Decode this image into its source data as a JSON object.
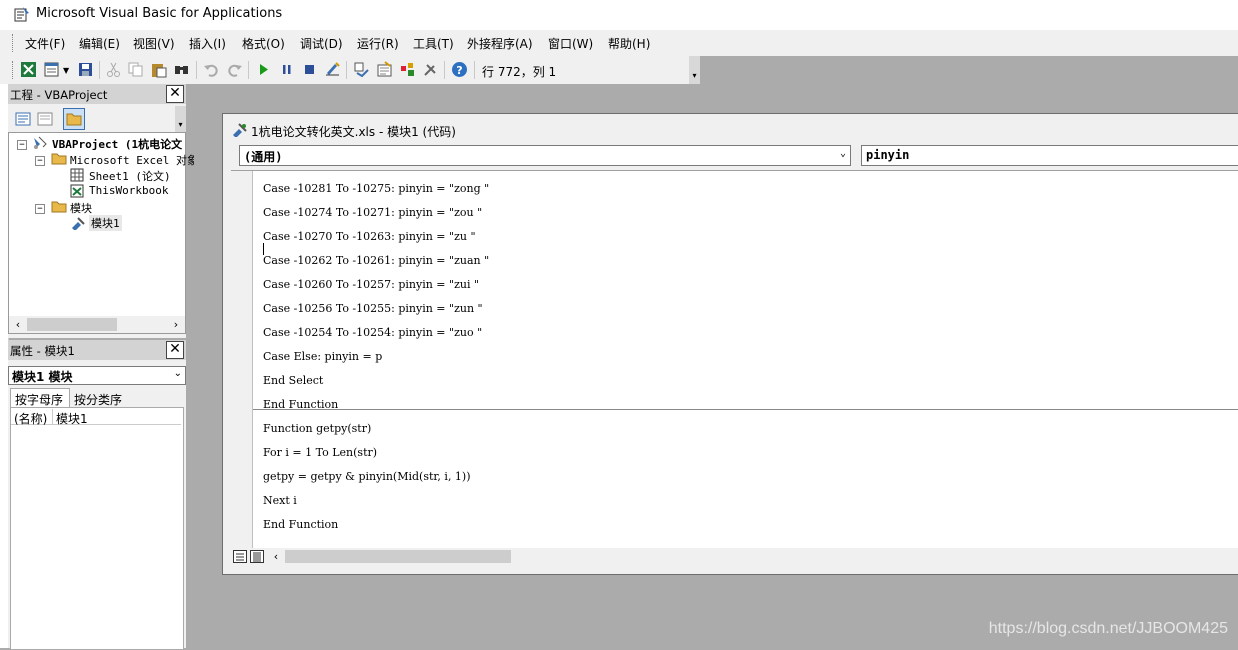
{
  "app": {
    "title": "Microsoft Visual Basic for Applications"
  },
  "menu": [
    "文件(F)",
    "编辑(E)",
    "视图(V)",
    "插入(I)",
    "格式(O)",
    "调试(D)",
    "运行(R)",
    "工具(T)",
    "外接程序(A)",
    "窗口(W)",
    "帮助(H)"
  ],
  "toolbar": {
    "position": "行 772，列 1",
    "icons": [
      "excel-icon",
      "insert-module-icon",
      "save-icon",
      "cut-icon",
      "copy-icon",
      "paste-icon",
      "find-icon",
      "undo-icon",
      "redo-icon",
      "run-icon",
      "break-icon",
      "reset-icon",
      "design-mode-icon",
      "project-explorer-icon",
      "properties-icon",
      "object-browser-icon",
      "toolbox-icon",
      "help-icon"
    ]
  },
  "project_panel": {
    "title": "工程 - VBAProject",
    "tree": {
      "root": "VBAProject (1杭电论文",
      "excel_objects": "Microsoft Excel 对象",
      "sheet1": "Sheet1 (论文)",
      "thisworkbook": "ThisWorkbook",
      "modules_folder": "模块",
      "module1": "模块1"
    }
  },
  "properties_panel": {
    "title": "属性 - 模块1",
    "object_select": "模块1 模块",
    "tabs": [
      "按字母序",
      "按分类序"
    ],
    "rows": [
      {
        "name": "(名称)",
        "value": "模块1"
      }
    ]
  },
  "code_window": {
    "title": "1杭电论文转化英文.xls - 模块1 (代码)",
    "object_combo": "(通用)",
    "proc_combo": "pinyin",
    "lines": [
      "Case -10281 To -10275: pinyin = \"zong \"",
      "Case -10274 To -10271: pinyin = \"zou \"",
      "Case -10270 To -10263: pinyin = \"zu \"",
      "Case -10262 To -10261: pinyin = \"zuan \"",
      "Case -10260 To -10257: pinyin = \"zui \"",
      "Case -10256 To -10255: pinyin = \"zun \"",
      "Case -10254 To -10254: pinyin = \"zuo \"",
      "Case Else: pinyin = p",
      "End Select",
      "End Function",
      "Function getpy(str)",
      "For i = 1 To Len(str)",
      "getpy = getpy & pinyin(Mid(str, i, 1))",
      "Next i",
      "End Function"
    ]
  },
  "watermark": "https://blog.csdn.net/JJBOOM425"
}
